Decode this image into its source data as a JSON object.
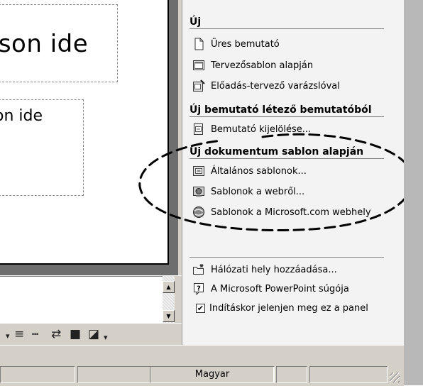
{
  "slide": {
    "title_placeholder_text": "tson ide",
    "body_placeholder_text": "on ide"
  },
  "task_pane": {
    "section_new": {
      "heading": "Új",
      "items": [
        {
          "label": "Üres bemutató",
          "icon": "blank-page-icon"
        },
        {
          "label": "Tervezősablon alapján",
          "icon": "design-template-icon"
        },
        {
          "label": "Előadás-tervező varázslóval",
          "icon": "wizard-icon"
        }
      ]
    },
    "section_from_existing": {
      "heading": "Új bemutató létező bemutatóból",
      "items": [
        {
          "label": "Bemutató kijelölése...",
          "icon": "choose-presentation-icon"
        }
      ]
    },
    "section_from_template": {
      "heading": "Új dokumentum sablon alapján",
      "items": [
        {
          "label": "Általános sablonok...",
          "icon": "general-templates-icon"
        },
        {
          "label": "Sablonok a webről...",
          "icon": "web-templates-icon"
        },
        {
          "label": "Sablonok a Microsoft.com webhely",
          "icon": "microsoft-globe-icon"
        }
      ]
    },
    "footer": {
      "add_network_place": "Hálózati hely hozzáadása...",
      "help": "A Microsoft PowerPoint súgója",
      "show_at_startup": "Indításkor jelenjen meg ez a panel",
      "show_at_startup_checked": true
    }
  },
  "status_bar": {
    "language": "Magyar"
  },
  "colors": {
    "chrome": "#d4d0c8",
    "editor_bg": "#6e6e6e",
    "task_pane_bg": "#f3f3f3"
  }
}
